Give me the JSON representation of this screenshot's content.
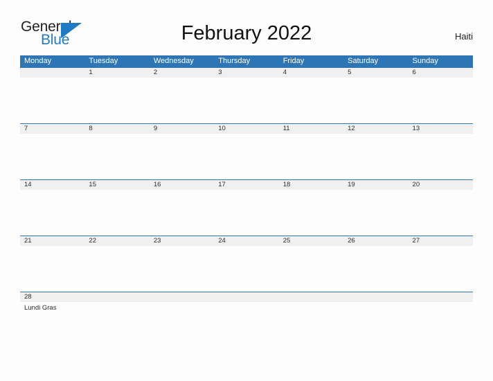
{
  "brand": {
    "name_part1": "General",
    "name_part2": "Blue",
    "triangle_icon": "triangle-logo-icon",
    "accent_color": "#1f7ac4"
  },
  "header": {
    "title": "February 2022",
    "region": "Haiti"
  },
  "colors": {
    "header_blue": "#2e75b6",
    "band_gray": "#f0f0f0",
    "page_background": "#fdfdfd",
    "text": "#2b2b2b"
  },
  "calendar": {
    "month": "February",
    "year": "2022",
    "weekday_headers": [
      "Monday",
      "Tuesday",
      "Wednesday",
      "Thursday",
      "Friday",
      "Saturday",
      "Sunday"
    ],
    "weeks": [
      {
        "days": [
          {
            "date": "",
            "events": []
          },
          {
            "date": "1",
            "events": []
          },
          {
            "date": "2",
            "events": []
          },
          {
            "date": "3",
            "events": []
          },
          {
            "date": "4",
            "events": []
          },
          {
            "date": "5",
            "events": []
          },
          {
            "date": "6",
            "events": []
          }
        ]
      },
      {
        "days": [
          {
            "date": "7",
            "events": []
          },
          {
            "date": "8",
            "events": []
          },
          {
            "date": "9",
            "events": []
          },
          {
            "date": "10",
            "events": []
          },
          {
            "date": "11",
            "events": []
          },
          {
            "date": "12",
            "events": []
          },
          {
            "date": "13",
            "events": []
          }
        ]
      },
      {
        "days": [
          {
            "date": "14",
            "events": []
          },
          {
            "date": "15",
            "events": []
          },
          {
            "date": "16",
            "events": []
          },
          {
            "date": "17",
            "events": []
          },
          {
            "date": "18",
            "events": []
          },
          {
            "date": "19",
            "events": []
          },
          {
            "date": "20",
            "events": []
          }
        ]
      },
      {
        "days": [
          {
            "date": "21",
            "events": []
          },
          {
            "date": "22",
            "events": []
          },
          {
            "date": "23",
            "events": []
          },
          {
            "date": "24",
            "events": []
          },
          {
            "date": "25",
            "events": []
          },
          {
            "date": "26",
            "events": []
          },
          {
            "date": "27",
            "events": []
          }
        ]
      },
      {
        "short": true,
        "days": [
          {
            "date": "28",
            "events": [
              "Lundi Gras"
            ]
          },
          {
            "date": "",
            "events": []
          },
          {
            "date": "",
            "events": []
          },
          {
            "date": "",
            "events": []
          },
          {
            "date": "",
            "events": []
          },
          {
            "date": "",
            "events": []
          },
          {
            "date": "",
            "events": []
          }
        ]
      }
    ]
  }
}
